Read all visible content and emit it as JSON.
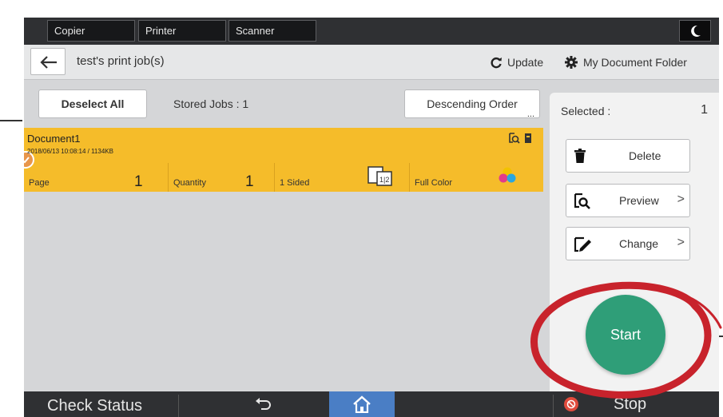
{
  "topbar": {
    "tabs": [
      {
        "label": "Copier"
      },
      {
        "label": "Printer"
      },
      {
        "label": "Scanner"
      }
    ],
    "night_icon": "moon-icon"
  },
  "titlebar": {
    "title": "test's print job(s)",
    "update_label": "Update",
    "folder_label": "My Document Folder"
  },
  "list": {
    "deselect_label": "Deselect All",
    "stored_jobs": "Stored Jobs : 1",
    "order_label": "Descending Order",
    "order_dots": "...",
    "job": {
      "name": "Document1",
      "date_size": "2018/06/13 10:08:14 / 1134KB",
      "page_label": "Page",
      "page_value": "1",
      "quantity_label": "Quantity",
      "quantity_value": "1",
      "sided_label": "1 Sided",
      "sided_icon_text": "1|2",
      "color_label": "Full Color",
      "row_color": "#f5bc2a"
    }
  },
  "panel": {
    "selected_label": "Selected :",
    "selected_value": "1",
    "delete_label": "Delete",
    "preview_label": "Preview",
    "change_label": "Change",
    "chevron": ">",
    "start_label": "Start",
    "start_color": "#2f9e78"
  },
  "bottombar": {
    "check_status": "Check Status",
    "stop_label": "Stop",
    "home_color": "#4a7ec5"
  }
}
